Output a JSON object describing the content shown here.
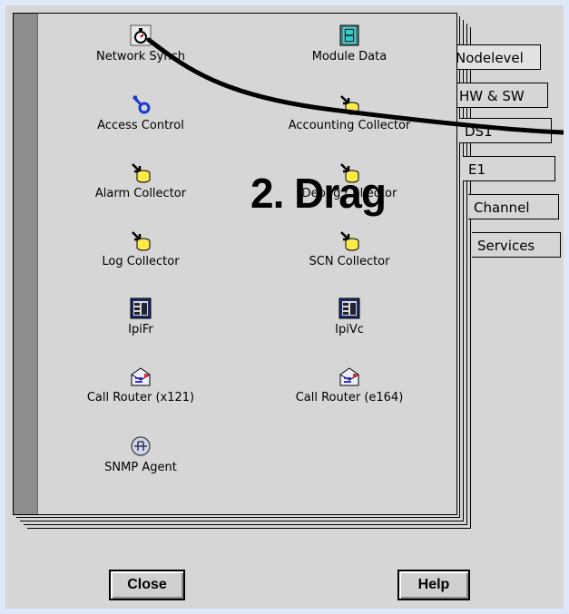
{
  "tools": [
    {
      "label": "Network Synch",
      "icon": "stopwatch-icon"
    },
    {
      "label": "Module Data",
      "icon": "module-data-icon"
    },
    {
      "label": "Access Control",
      "icon": "key-icon"
    },
    {
      "label": "Accounting Collector",
      "icon": "collector-icon"
    },
    {
      "label": "Alarm Collector",
      "icon": "collector-icon"
    },
    {
      "label": "Debug Collector",
      "icon": "collector-icon"
    },
    {
      "label": "Log Collector",
      "icon": "collector-icon"
    },
    {
      "label": "SCN Collector",
      "icon": "collector-icon"
    },
    {
      "label": "IpiFr",
      "icon": "grid-app-icon"
    },
    {
      "label": "IpiVc",
      "icon": "grid-app-icon"
    },
    {
      "label": "Call Router (x121)",
      "icon": "call-router-icon"
    },
    {
      "label": "Call Router (e164)",
      "icon": "call-router-icon"
    },
    {
      "label": "SNMP Agent",
      "icon": "snmp-agent-icon"
    }
  ],
  "tabs": [
    "Nodelevel",
    "HW & SW",
    "DS1",
    "E1",
    "Channel",
    "Services"
  ],
  "annotation": {
    "text": "2. Drag"
  },
  "buttons": {
    "close": "Close",
    "help": "Help"
  },
  "colors": {
    "background": "#dfe8f8",
    "panel": "#d6d6d6",
    "spine": "#8d8d8d"
  }
}
